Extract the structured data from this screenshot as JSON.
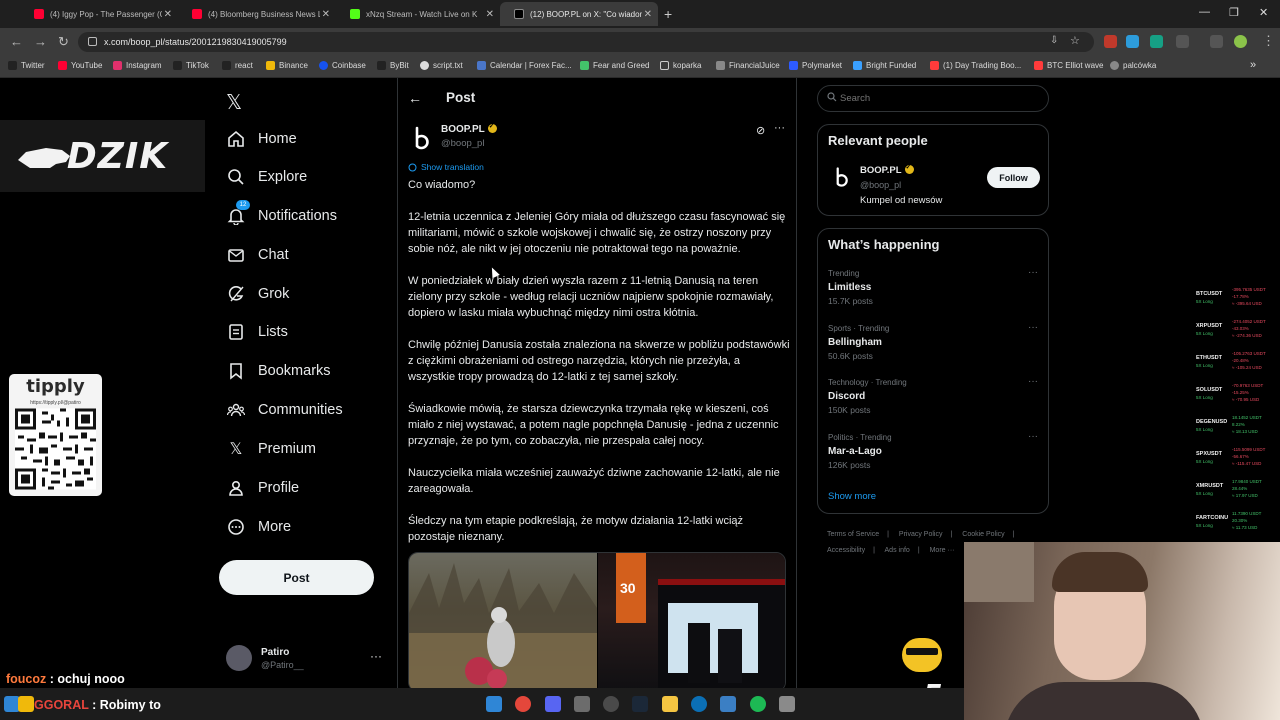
{
  "browser": {
    "tabs": [
      {
        "title": "(4) Iggy Pop - The Passenger (C",
        "favicon_color": "#ff0033",
        "active": false
      },
      {
        "title": "(4) Bloomberg Business News L",
        "favicon_color": "#ff0033",
        "active": false
      },
      {
        "title": "xNzq Stream - Watch Live on K",
        "favicon_color": "#53fc18",
        "active": false
      },
      {
        "title": "(12) BOOP.PL on X: \"Co wiadom",
        "favicon_color": "#ffffff",
        "active": true
      }
    ],
    "url": "x.com/boop_pl/status/2001219830419005799",
    "bookmarks": [
      {
        "label": "Twitter",
        "color": "#e7e9ea"
      },
      {
        "label": "YouTube",
        "color": "#ff0033"
      },
      {
        "label": "Instagram",
        "color": "#e1306c"
      },
      {
        "label": "TikTok",
        "color": "#e7e9ea"
      },
      {
        "label": "react",
        "color": "#e7e9ea"
      },
      {
        "label": "Binance",
        "color": "#f0b90b"
      },
      {
        "label": "Coinbase",
        "color": "#1652f0"
      },
      {
        "label": "ByBit",
        "color": "#f7a600"
      },
      {
        "label": "script.txt",
        "color": "#e7e9ea"
      },
      {
        "label": "Calendar | Forex Fac...",
        "color": "#4a76c9"
      },
      {
        "label": "Fear and Greed",
        "color": "#43c36a"
      },
      {
        "label": "koparka",
        "color": "#cccccc"
      },
      {
        "label": "FinancialJuice",
        "color": "#e8e8e8"
      },
      {
        "label": "Polymarket",
        "color": "#2d5bff"
      },
      {
        "label": "Bright Funded",
        "color": "#3aa0ff"
      },
      {
        "label": "(1) Day Trading Boo...",
        "color": "#ff3b3b"
      },
      {
        "label": "BTC Elliot wave",
        "color": "#ff3b3b"
      },
      {
        "label": "palcówka",
        "color": "#cccccc"
      }
    ]
  },
  "overlay": {
    "dzik": "DZIK",
    "tipply_brand": "tipply",
    "tipply_url": "https://tipply.pl/@patiro"
  },
  "nav": {
    "items": [
      {
        "label": "Home",
        "icon": "home-icon"
      },
      {
        "label": "Explore",
        "icon": "search-icon"
      },
      {
        "label": "Notifications",
        "icon": "bell-icon"
      },
      {
        "label": "Chat",
        "icon": "mail-icon"
      },
      {
        "label": "Grok",
        "icon": "grok-icon"
      },
      {
        "label": "Lists",
        "icon": "list-icon"
      },
      {
        "label": "Bookmarks",
        "icon": "bookmark-icon"
      },
      {
        "label": "Communities",
        "icon": "communities-icon"
      },
      {
        "label": "Premium",
        "icon": "x-icon"
      },
      {
        "label": "Profile",
        "icon": "person-icon"
      },
      {
        "label": "More",
        "icon": "more-circle-icon"
      }
    ],
    "notifications_badge": "12",
    "post_label": "Post",
    "profile": {
      "name": "Patiro",
      "handle": "@Patiro__"
    }
  },
  "main": {
    "title": "Post",
    "author": {
      "name": "BOOP.PL",
      "handle": "@boop_pl"
    },
    "show_translation": "Show translation",
    "paragraphs": [
      "Co wiadomo?",
      "12-letnia uczennica z Jeleniej Góry miała od dłuższego czasu fascynować się militariami, mówić o szkole wojskowej i chwalić się, że ostrzy noszony przy sobie nóż, ale nikt w jej otoczeniu nie potraktował tego na poważnie.",
      "W poniedziałek w biały dzień wyszła razem z 11-letnią Danusią na teren zielony przy szkole - według relacji uczniów najpierw spokojnie rozmawiały, dopiero w lasku miała wybuchnąć między nimi ostra kłótnia.",
      "Chwilę później Danusia została znaleziona na skwerze w pobliżu podstawówki z ciężkimi obrażeniami od ostrego narzędzia, których nie przeżyła, a wszystkie tropy prowadzą do 12-latki z tej samej szkoły.",
      "Świadkowie mówią, że starsza dziewczynka trzymała rękę w kieszeni, coś miało z niej wystawać, a potem nagle popchnęła Danusię - jedna z uczennic przyznaje, że po tym, co zobaczyła, nie przespała całej nocy.",
      "Nauczycielka miała wcześniej zauważyć dziwne zachowanie 12-latki, ale nie zareagowała.",
      "Śledczy na tym etapie podkreślają, że motyw działania 12-latki wciąż pozostaje nieznany."
    ]
  },
  "right": {
    "search_placeholder": "Search",
    "relevant_title": "Relevant people",
    "relevant_person": {
      "name": "BOOP.PL",
      "handle": "@boop_pl",
      "bio": "Kumpel od newsów",
      "follow_label": "Follow"
    },
    "happening_title": "What’s happening",
    "trends": [
      {
        "meta": "Trending",
        "name": "Limitless",
        "count": "15.7K posts"
      },
      {
        "meta": "Sports · Trending",
        "name": "Bellingham",
        "count": "50.6K posts"
      },
      {
        "meta": "Technology · Trending",
        "name": "Discord",
        "count": "150K posts"
      },
      {
        "meta": "Politics · Trending",
        "name": "Mar-a-Lago",
        "count": "126K posts"
      }
    ],
    "show_more": "Show more",
    "footer": [
      "Terms of Service",
      "|",
      "Privacy Policy",
      "|",
      "Cookie Policy",
      "|",
      "Accessibility",
      "|",
      "Ads info",
      "|",
      "More ···"
    ]
  },
  "ticker": [
    {
      "sym": "BTCUSDT",
      "sub": "5X Long",
      "v1": "-395.7635 USDT",
      "v2": "-17.78%",
      "v3": "≈ -395.64 USD",
      "sign": "neg"
    },
    {
      "sym": "XRPUSDT",
      "sub": "5X Long",
      "v1": "-274.4052 USDT",
      "v2": "-43.03%",
      "v3": "≈ -274.36 USD",
      "sign": "neg"
    },
    {
      "sym": "ETHUSDT",
      "sub": "5X Long",
      "v1": "-105.2763 USDT",
      "v2": "-20.48%",
      "v3": "≈ -105.24 USD",
      "sign": "neg"
    },
    {
      "sym": "SOLUSDT",
      "sub": "5X Long",
      "v1": "-70.9763 USDT",
      "v2": "-15.25%",
      "v3": "≈ -70.95 USD",
      "sign": "neg"
    },
    {
      "sym": "DEGENUSD",
      "sub": "5X Long",
      "v1": "18.1452 USDT",
      "v2": "8.22%",
      "v3": "≈ 18.13 USD",
      "sign": "pos"
    },
    {
      "sym": "SPXUSDT",
      "sub": "5X Long",
      "v1": "-115.5099 USDT",
      "v2": "-56.67%",
      "v3": "≈ -115.47 USD",
      "sign": "neg"
    },
    {
      "sym": "XMRUSDT",
      "sub": "5X Long",
      "v1": "17.9840 USDT",
      "v2": "28.44%",
      "v3": "≈ 17.97 USD",
      "sign": "pos"
    },
    {
      "sym": "FARTCOINU",
      "sub": "5X Long",
      "v1": "11.7390 USDT",
      "v2": "20.30%",
      "v3": "≈ 11.73 USD",
      "sign": "pos"
    }
  ],
  "emote": {
    "multiplier": "x5"
  },
  "chat": [
    {
      "user": "foucoz",
      "message": ": ochuj nooo"
    },
    {
      "user": "GGORAL",
      "message": ": Robimy to"
    }
  ]
}
